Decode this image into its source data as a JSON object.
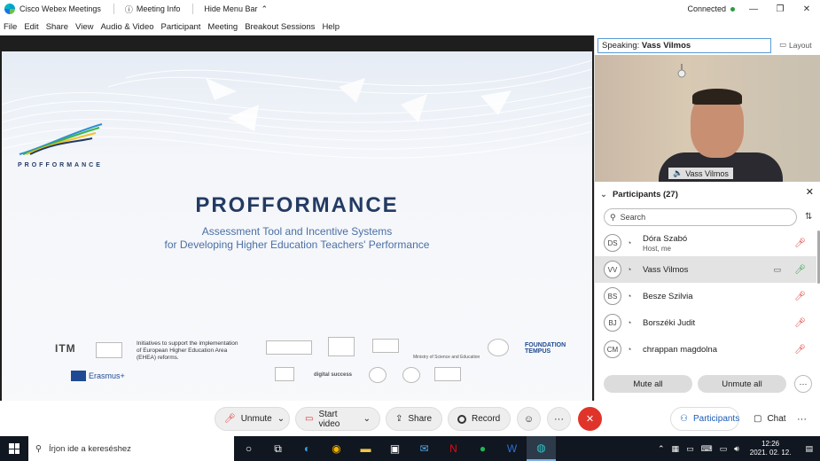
{
  "titlebar": {
    "app_name": "Cisco Webex Meetings",
    "meeting_info": "Meeting Info",
    "hide_menu": "Hide Menu Bar",
    "status": "Connected",
    "status_color": "#2a9d3f"
  },
  "menu": {
    "items": [
      "File",
      "Edit",
      "Share",
      "View",
      "Audio & Video",
      "Participant",
      "Meeting",
      "Breakout Sessions",
      "Help"
    ]
  },
  "slide": {
    "logo_text": "PROFFORMANCE",
    "title": "PROFFORMANCE",
    "subtitle1": "Assessment Tool and Incentive Systems",
    "subtitle2": "for Developing Higher Education Teachers' Performance",
    "initiatives": "Initiatives to support the implementation of European Higher Education Area (EHEA) reforms.",
    "itm": "ITM",
    "erasmus": "Erasmus+",
    "ministry": "Ministry of Science and Education",
    "tempus": "FOUNDATION TEMPUS",
    "digital": "digital success"
  },
  "right_panel": {
    "speaking_label": "Speaking:",
    "speaking_name": "Vass Vilmos",
    "layout_label": "Layout",
    "video_name": "Vass Vilmos",
    "participants_title": "Participants (27)",
    "search_placeholder": "Search",
    "participants": [
      {
        "initials": "DS",
        "name": "Dóra Szabó",
        "sub": "Host, me"
      },
      {
        "initials": "VV",
        "name": "Vass Vilmos",
        "sub": ""
      },
      {
        "initials": "BS",
        "name": "Besze Szilvia",
        "sub": ""
      },
      {
        "initials": "BJ",
        "name": "Borszéki Judit",
        "sub": ""
      },
      {
        "initials": "CM",
        "name": "chrappan magdolna",
        "sub": ""
      }
    ],
    "mute_all": "Mute all",
    "unmute_all": "Unmute all"
  },
  "controls": {
    "unmute": "Unmute",
    "start_video": "Start video",
    "share": "Share",
    "record": "Record",
    "participants": "Participants",
    "chat": "Chat"
  },
  "taskbar": {
    "search_placeholder": "Írjon ide a kereséshez",
    "time": "12:26",
    "date": "2021. 02. 12."
  }
}
